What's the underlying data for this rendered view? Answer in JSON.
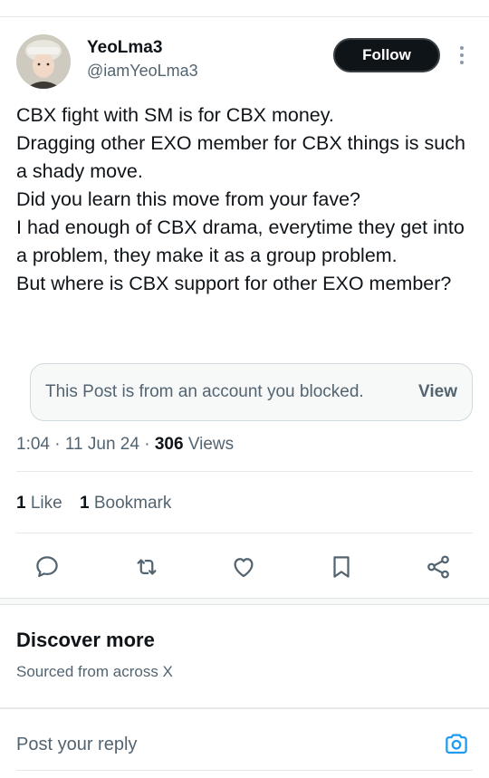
{
  "post": {
    "author": {
      "display_name": "YeoLma3",
      "handle": "@iamYeoLma3"
    },
    "follow_label": "Follow",
    "text": "CBX fight with SM is for CBX money.\nDragging other EXO member for CBX things is such a shady move.\nDid you learn this move from your fave?\nI had enough of CBX drama, everytime they get into a problem, they make it as a group problem.\nBut where is CBX support for other EXO member?",
    "blocked_notice": {
      "text": "This Post is from an account you blocked.",
      "view_label": "View"
    },
    "meta": {
      "time": "1:04",
      "date": "11 Jun 24",
      "views_count": "306",
      "views_label": "Views",
      "separator": " · "
    },
    "stats": {
      "likes_count": "1",
      "likes_label": "Like",
      "bookmarks_count": "1",
      "bookmarks_label": "Bookmark"
    },
    "actions": [
      "reply-icon",
      "repost-icon",
      "like-icon",
      "bookmark-icon",
      "share-icon"
    ],
    "icon_color": "#536471"
  },
  "discover": {
    "title": "Discover more",
    "subtitle": "Sourced from across X"
  },
  "reply": {
    "placeholder": "Post your reply",
    "camera_color": "#1d9bf0"
  }
}
